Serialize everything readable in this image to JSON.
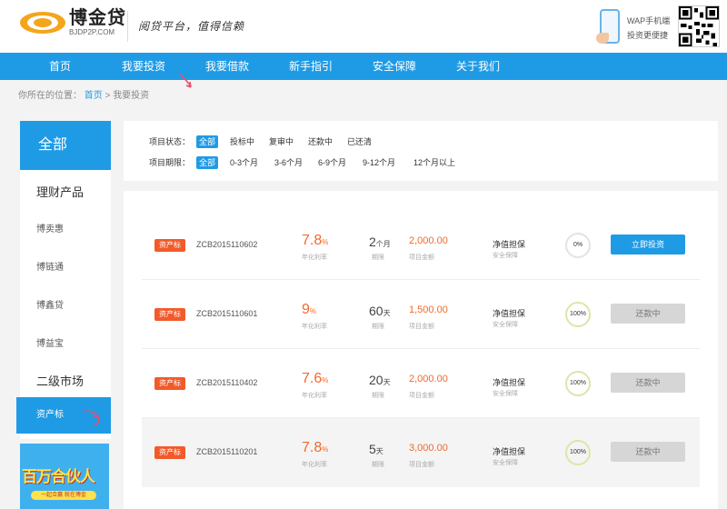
{
  "header": {
    "logo_cn": "博金贷",
    "logo_en": "BJDP2P.COM",
    "slogan": "阅贷平台，值得信赖",
    "wap_line1": "WAP手机端",
    "wap_line2": "投资更便捷"
  },
  "nav": [
    "首页",
    "我要投资",
    "我要借款",
    "新手指引",
    "安全保障",
    "关于我们"
  ],
  "breadcrumb": {
    "prefix": "你所在的位置：",
    "home": "首页",
    "sep": ">",
    "current": "我要投资"
  },
  "sidebar": {
    "all": "全部",
    "items": [
      "理财产品",
      "博卖惠",
      "博链通",
      "博鑫贷",
      "博益宝",
      "二级市场"
    ],
    "active": "资产标"
  },
  "banner": {
    "title": "百万合伙人",
    "strip": "一起合赢 就在博金"
  },
  "filters": {
    "status_label": "项目状态：",
    "status_options": [
      "全部",
      "投标中",
      "复审中",
      "还款中",
      "已还清"
    ],
    "term_label": "项目期限：",
    "term_options": [
      "全部",
      "0-3个月",
      "3-6个月",
      "6-9个月",
      "9-12个月",
      "12个月以上"
    ]
  },
  "list_labels": {
    "rate": "年化利率",
    "term": "期限",
    "amount": "项目金额",
    "guarantee_sub": "安全保障"
  },
  "projects": [
    {
      "tag": "资产标",
      "code": "ZCB2015110602",
      "rate": "7.8",
      "rate_unit": "%",
      "term": "2",
      "term_unit": "个月",
      "amount": "2,000.00",
      "guarantee": "净值担保",
      "progress": "0%",
      "button": "立即投资"
    },
    {
      "tag": "资产标",
      "code": "ZCB2015110601",
      "rate": "9",
      "rate_unit": "%",
      "term": "60",
      "term_unit": "天",
      "amount": "1,500.00",
      "guarantee": "净值担保",
      "progress": "100%",
      "button": "还款中"
    },
    {
      "tag": "资产标",
      "code": "ZCB2015110402",
      "rate": "7.6",
      "rate_unit": "%",
      "term": "20",
      "term_unit": "天",
      "amount": "2,000.00",
      "guarantee": "净值担保",
      "progress": "100%",
      "button": "还款中"
    },
    {
      "tag": "资产标",
      "code": "ZCB2015110201",
      "rate": "7.8",
      "rate_unit": "%",
      "term": "5",
      "term_unit": "天",
      "amount": "3,000.00",
      "guarantee": "净值担保",
      "progress": "100%",
      "button": "还款中"
    }
  ],
  "colors": {
    "primary": "#1f9be6",
    "accent": "#f06a2a",
    "tag": "#f25a2a"
  }
}
